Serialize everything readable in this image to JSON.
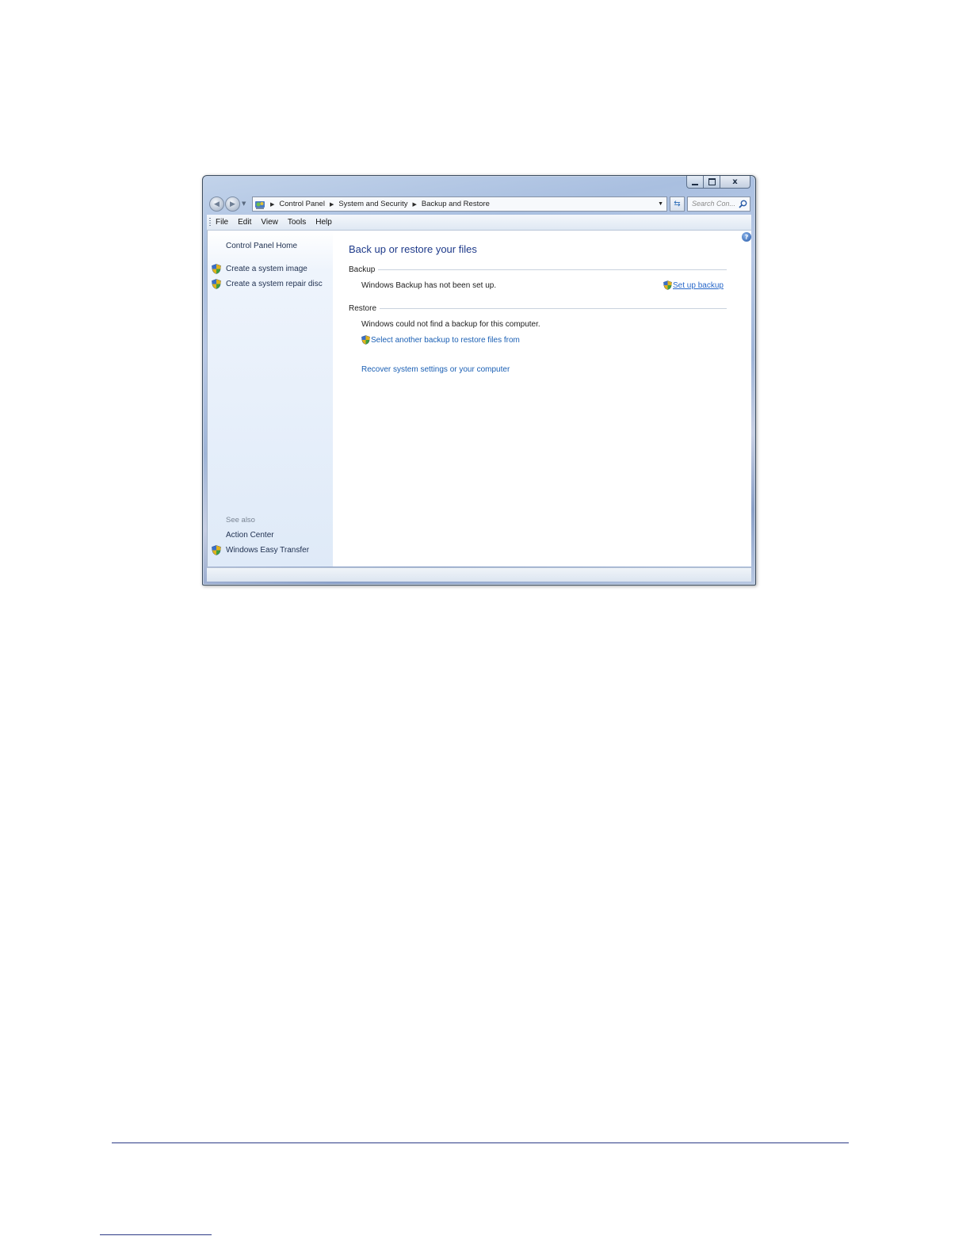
{
  "window": {
    "caption": {
      "minimize": "–",
      "maximize": "□",
      "close": "x"
    }
  },
  "navigation": {
    "breadcrumbs": [
      "Control Panel",
      "System and Security",
      "Backup and Restore"
    ],
    "search_placeholder": "Search Con..."
  },
  "menu": [
    "File",
    "Edit",
    "View",
    "Tools",
    "Help"
  ],
  "sidebar": {
    "home": "Control Panel Home",
    "tasks": [
      "Create a system image",
      "Create a system repair disc"
    ],
    "see_also_label": "See also",
    "see_also": [
      "Action Center",
      "Windows Easy Transfer"
    ]
  },
  "main": {
    "title": "Back up or restore your files",
    "backup": {
      "heading": "Backup",
      "status": "Windows Backup has not been set up.",
      "action": "Set up backup"
    },
    "restore": {
      "heading": "Restore",
      "status": "Windows could not find a backup for this computer.",
      "select_link": "Select another backup to restore files from",
      "recover_link": "Recover system settings or your computer"
    }
  },
  "icons": {
    "uac_shield": "uac-shield-icon",
    "help": "help-icon",
    "search": "search-icon",
    "refresh": "refresh-icon",
    "control_panel": "control-panel-icon"
  },
  "colors": {
    "link": "#1a5fb4",
    "title": "#1e3a8a",
    "sidebar_bg": "#dfeaf8",
    "footer_rule": "#2c3a86"
  }
}
